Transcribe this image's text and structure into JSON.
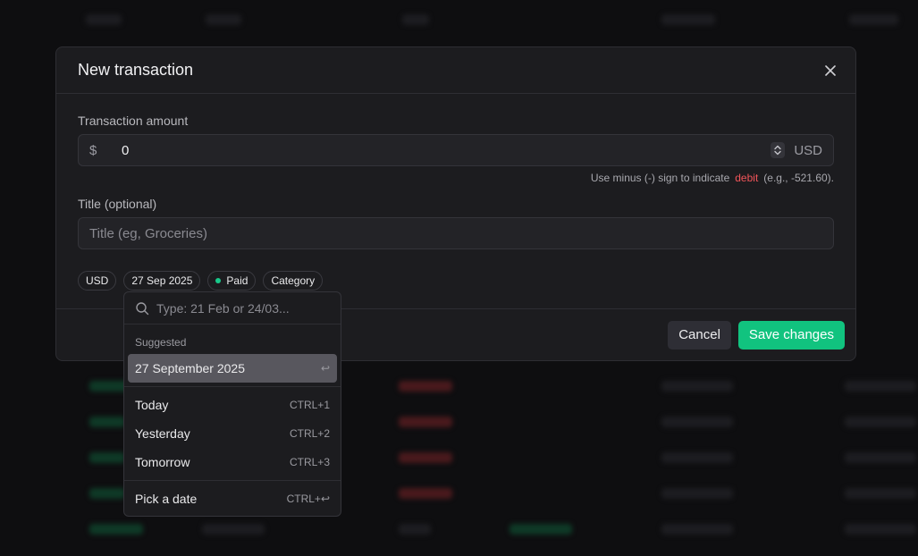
{
  "modal": {
    "title": "New transaction",
    "amount_label": "Transaction amount",
    "currency_symbol": "$",
    "amount_value": "0",
    "currency_code": "USD",
    "hint_prefix": "Use minus (-) sign to indicate",
    "hint_debit": "debit",
    "hint_suffix": "(e.g., -521.60).",
    "title_label": "Title (optional)",
    "title_placeholder": "Title (eg, Groceries)",
    "chips": {
      "currency": "USD",
      "date": "27 Sep 2025",
      "status": "Paid",
      "category": "Category"
    },
    "cancel_label": "Cancel",
    "save_label": "Save changes"
  },
  "date_picker": {
    "search_placeholder": "Type: 21 Feb or 24/03...",
    "suggested_label": "Suggested",
    "suggested_item": "27 September 2025",
    "suggested_shortcut": "↩",
    "items": [
      {
        "label": "Today",
        "shortcut": "CTRL+1"
      },
      {
        "label": "Yesterday",
        "shortcut": "CTRL+2"
      },
      {
        "label": "Tomorrow",
        "shortcut": "CTRL+3"
      }
    ],
    "pick_label": "Pick a date",
    "pick_shortcut": "CTRL+↩"
  },
  "colors": {
    "accent": "#11c37f",
    "debit": "#f2555a",
    "paid_dot": "#18c98a"
  }
}
